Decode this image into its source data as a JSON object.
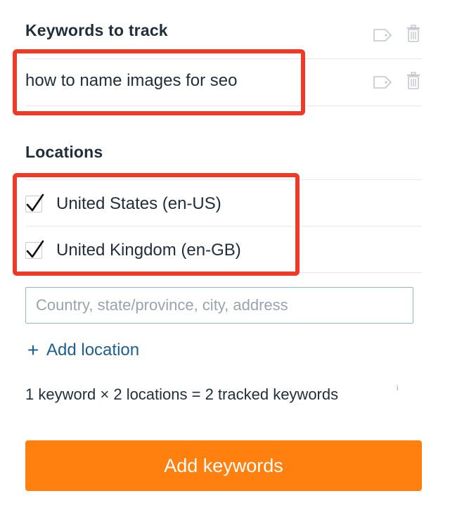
{
  "keywords": {
    "title": "Keywords to track",
    "items": [
      {
        "text": "how to name images for seo",
        "tag_icon": "tag-icon",
        "delete_icon": "trash-icon"
      }
    ],
    "header_icons": [
      "tag-icon",
      "trash-icon"
    ]
  },
  "locations": {
    "title": "Locations",
    "items": [
      {
        "label": "United States (en-US)",
        "checked": true
      },
      {
        "label": "United Kingdom (en-GB)",
        "checked": true
      }
    ],
    "search_placeholder": "Country, state/province, city, address",
    "search_value": "",
    "add_location_label": "Add location",
    "add_location_icon": "plus-icon"
  },
  "summary": {
    "text": "1 keyword × 2 locations = 2 tracked keywords",
    "info_icon_glyph": "i"
  },
  "actions": {
    "submit_label": "Add keywords"
  },
  "colors": {
    "accent_button": "#ff7f0f",
    "highlight_box": "#f03a28",
    "link": "#1b5f8f",
    "input_border": "#8fb6cf"
  }
}
